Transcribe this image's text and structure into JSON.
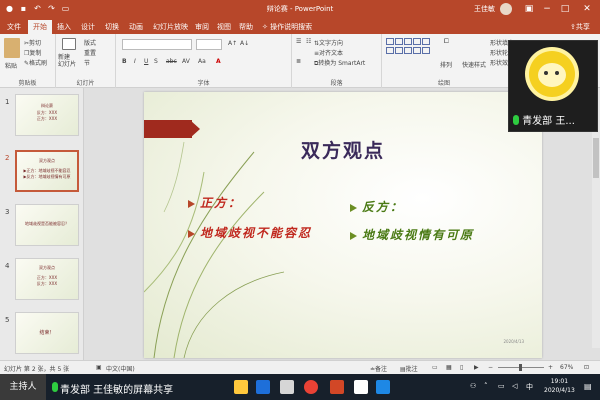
{
  "window": {
    "title": "辩论赛 - PowerPoint",
    "user": "王佳敏",
    "share_label": "共享"
  },
  "tabs": [
    {
      "label": "文件",
      "active": false
    },
    {
      "label": "开始",
      "active": true
    },
    {
      "label": "插入",
      "active": false
    },
    {
      "label": "设计",
      "active": false
    },
    {
      "label": "切换",
      "active": false
    },
    {
      "label": "动画",
      "active": false
    },
    {
      "label": "幻灯片放映",
      "active": false
    },
    {
      "label": "审阅",
      "active": false
    },
    {
      "label": "视图",
      "active": false
    },
    {
      "label": "帮助",
      "active": false
    }
  ],
  "tell_me": "操作说明搜索",
  "ribbon": {
    "clipboard": {
      "paste": "粘贴",
      "cut": "剪切",
      "copy": "复制",
      "format_painter": "格式刷",
      "label": "剪贴板"
    },
    "slides": {
      "new_slide": "新建\n幻灯片",
      "layout": "版式",
      "reset": "重置",
      "section": "节",
      "label": "幻灯片"
    },
    "font": {
      "label": "字体",
      "bold": "B",
      "italic": "I",
      "underline": "U",
      "strike": "S",
      "shadow": "abc",
      "spacing": "AV",
      "case": "Aa",
      "color": "A"
    },
    "paragraph": {
      "text_direction": "文字方向",
      "align_text": "对齐文本",
      "smartart": "转换为 SmartArt",
      "label": "段落"
    },
    "drawing": {
      "arrange": "排列",
      "quick_styles": "快速样式",
      "fill": "形状填充",
      "outline": "形状轮廓",
      "effects": "形状效果",
      "label": "绘图"
    }
  },
  "thumbnails": [
    {
      "num": "1",
      "lines": [
        "辩论赛",
        "反方：XXX",
        "正方：XXX"
      ]
    },
    {
      "num": "2",
      "lines": [
        "双方观点",
        "▶正方：地域歧视不能容忍",
        "▶反方：地域歧视情有可原"
      ],
      "selected": true
    },
    {
      "num": "3",
      "lines": [
        "地域歧视是否能被容忍？"
      ]
    },
    {
      "num": "4",
      "lines": [
        "双方观点",
        "正方：XXX",
        "反方：XXX"
      ]
    },
    {
      "num": "5",
      "lines": [
        "结束！"
      ]
    }
  ],
  "slide": {
    "title": "双方观点",
    "pro_label": "正方：",
    "pro_text": "地域歧视不能容忍",
    "con_label": "反方：",
    "con_text": "地域歧视情有可原",
    "date": "2020/4/13"
  },
  "webcam": {
    "name": "青发部 王..."
  },
  "status": {
    "slide_info": "幻灯片 第 2 张，共 5 张",
    "language": "中文(中国)",
    "notes": "备注",
    "comments": "批注",
    "zoom": "67%"
  },
  "taskbar": {
    "host": "主持人",
    "sharing": "青发部 王佳敏的屏幕共享",
    "time": "19:01",
    "date": "2020/4/13"
  }
}
